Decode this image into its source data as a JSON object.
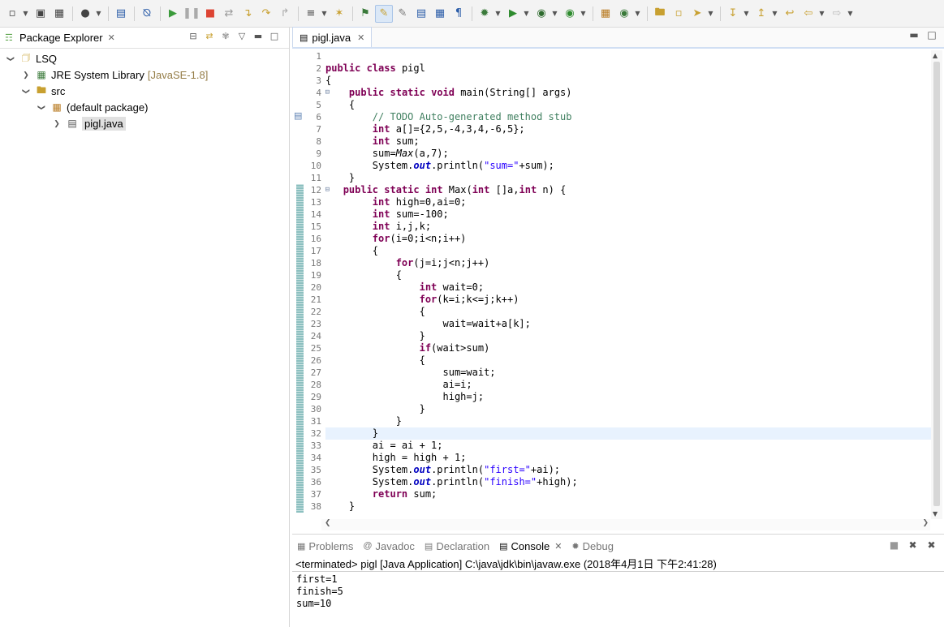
{
  "toolbar": {
    "icons": [
      "new-icon",
      "save-icon",
      "save-all-icon",
      "profile-icon",
      "terminal-icon",
      "skip-breakpoints-icon",
      "resume-icon",
      "suspend-icon",
      "terminate-icon",
      "disconnect-icon",
      "step-into-icon",
      "step-over-icon",
      "step-return-icon",
      "toggle-marks-icon",
      "annotation-icon",
      "open-type-icon",
      "highlight-icon",
      "mark-occurrences-icon",
      "task-icon",
      "show-whitespace-icon",
      "pilcrow-icon",
      "debug-icon",
      "run-icon",
      "coverage-icon",
      "external-tools-icon",
      "new-java-project-icon",
      "new-package-icon",
      "open-folder-icon",
      "open-project-icon",
      "search-icon",
      "next-annotation-icon",
      "prev-annotation-icon",
      "last-edit-icon",
      "back-icon",
      "forward-icon"
    ]
  },
  "explorer": {
    "tab_label": "Package Explorer",
    "tree": [
      {
        "label": "LSQ",
        "icon": "project-icon",
        "twisty": "expanded",
        "indent": 0
      },
      {
        "label": "JRE System Library",
        "deco": "[JavaSE-1.8]",
        "icon": "library-icon",
        "twisty": "collapsed",
        "indent": 1
      },
      {
        "label": "src",
        "icon": "source-folder-icon",
        "twisty": "expanded",
        "indent": 1
      },
      {
        "label": "(default package)",
        "icon": "package-icon",
        "twisty": "expanded",
        "indent": 2
      },
      {
        "label": "pigl.java",
        "icon": "java-file-icon",
        "twisty": "collapsed",
        "indent": 3,
        "selected": true
      }
    ]
  },
  "editor": {
    "tab_label": "pigl.java",
    "current_line": 32,
    "lines": [
      "",
      "public class pigl",
      "{",
      "    public static void main(String[] args)",
      "    {",
      "        // TODO Auto-generated method stub",
      "        int a[]={2,5,-4,3,4,-6,5};",
      "        int sum;",
      "        sum=Max(a,7);",
      "        System.out.println(\"sum=\"+sum);",
      "    }",
      "   public static int Max(int []a,int n) {",
      "        int high=0,ai=0;",
      "        int sum=-100;",
      "        int i,j,k;",
      "        for(i=0;i<n;i++)",
      "        {",
      "            for(j=i;j<n;j++)",
      "            {",
      "                int wait=0;",
      "                for(k=i;k<=j;k++)",
      "                {",
      "                    wait=wait+a[k];",
      "                }",
      "                if(wait>sum)",
      "                {",
      "                    sum=wait;",
      "                    ai=i;",
      "                    high=j;",
      "                }",
      "            }",
      "        }",
      "        ai = ai + 1;",
      "        high = high + 1;",
      "        System.out.println(\"first=\"+ai);",
      "        System.out.println(\"finish=\"+high);",
      "        return sum;",
      "    }"
    ]
  },
  "console": {
    "tabs": [
      {
        "label": "Problems",
        "icon": "problems-icon",
        "active": false
      },
      {
        "label": "Javadoc",
        "icon": "javadoc-icon",
        "active": false
      },
      {
        "label": "Declaration",
        "icon": "declaration-icon",
        "active": false
      },
      {
        "label": "Console",
        "icon": "console-icon",
        "active": true
      },
      {
        "label": "Debug",
        "icon": "debug-view-icon",
        "active": false
      }
    ],
    "header": "<terminated> pigl [Java Application] C:\\java\\jdk\\bin\\javaw.exe (2018年4月1日 下午2:41:28)",
    "output": [
      "first=1",
      "finish=5",
      "sum=10"
    ]
  },
  "colors": {
    "keyword": "#7f0055",
    "comment": "#3f7f5f",
    "string": "#2a00ff",
    "field": "#0000c0",
    "current_line": "#e8f2fe"
  }
}
